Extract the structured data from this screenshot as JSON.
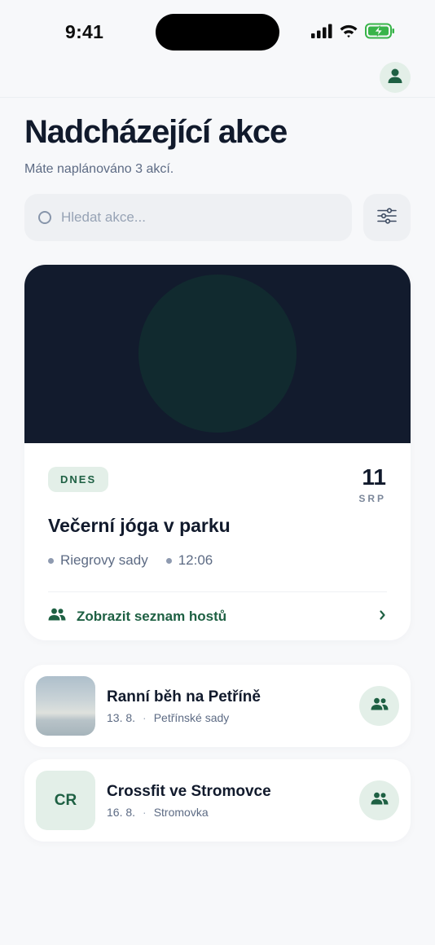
{
  "status_bar": {
    "time": "9:41"
  },
  "header": {
    "title": "Nadcházející akce",
    "subtitle": "Máte naplánováno 3 akcí."
  },
  "search": {
    "placeholder": "Hledat akce..."
  },
  "colors": {
    "accent": "#1e6043",
    "accent_soft": "#e3efe8",
    "hero_background": "#121b2d",
    "text_primary": "#111a2c",
    "text_secondary": "#5d6b84",
    "page_background": "#f7f8fa"
  },
  "featured": {
    "badge": "DNES",
    "day": "11",
    "month": "SRP",
    "title": "Večerní jóga v parku",
    "location": "Riegrovy sady",
    "time": "12:06",
    "guest_link": "Zobrazit seznam hostů"
  },
  "events": [
    {
      "title": "Ranní běh na Petříně",
      "date": "13. 8.",
      "location": "Petřínské sady",
      "thumbnail": "photo"
    },
    {
      "title": "Crossfit ve Stromovce",
      "date": "16. 8.",
      "location": "Stromovka",
      "initials": "CR"
    }
  ]
}
